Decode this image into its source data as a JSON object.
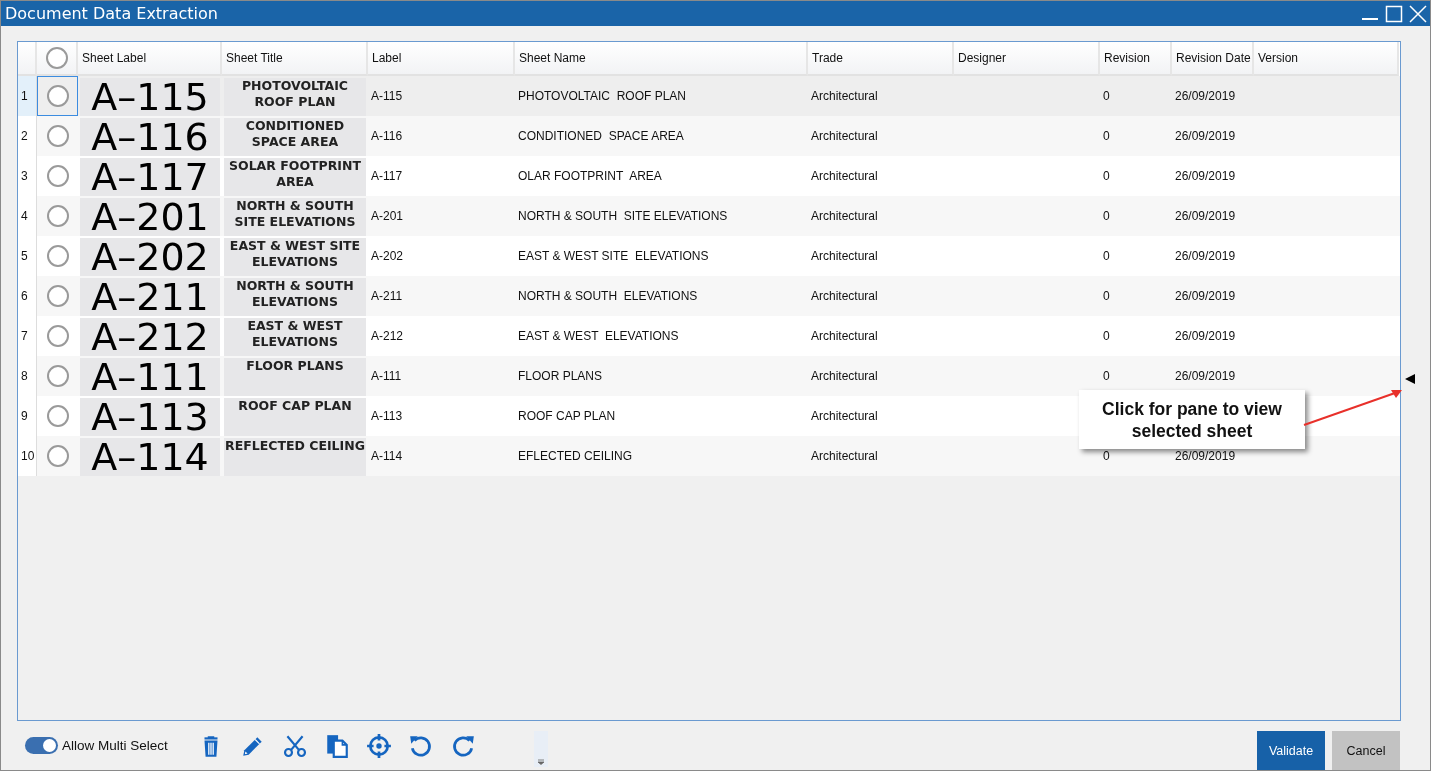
{
  "window": {
    "title": "Document Data Extraction"
  },
  "table": {
    "columns": [
      "Sheet Label",
      "Sheet Title",
      "Label",
      "Sheet Name",
      "Trade",
      "Designer",
      "Revision",
      "Revision Date",
      "Version"
    ],
    "header_checked": false,
    "rows": [
      {
        "number": "1",
        "selected": true,
        "checked": false,
        "sheet_label": "A–115",
        "sheet_title": "PHOTOVOLTAIC\nROOF PLAN",
        "label": "A-115",
        "sheet_name": "PHOTOVOLTAIC  ROOF PLAN",
        "trade": "Architectural",
        "revision": "0",
        "revision_date": "26/09/2019"
      },
      {
        "number": "2",
        "selected": false,
        "checked": false,
        "sheet_label": "A–116",
        "sheet_title": "CONDITIONED\nSPACE AREA",
        "label": "A-116",
        "sheet_name": "CONDITIONED  SPACE AREA",
        "trade": "Architectural",
        "revision": "0",
        "revision_date": "26/09/2019"
      },
      {
        "number": "3",
        "selected": false,
        "checked": false,
        "sheet_label": "A–117",
        "sheet_title": "SOLAR FOOTPRINT\nAREA",
        "label": "A-117",
        "sheet_name": "OLAR FOOTPRINT  AREA",
        "trade": "Architectural",
        "revision": "0",
        "revision_date": "26/09/2019"
      },
      {
        "number": "4",
        "selected": false,
        "checked": false,
        "sheet_label": "A–201",
        "sheet_title": "NORTH & SOUTH\nSITE ELEVATIONS",
        "label": "A-201",
        "sheet_name": "NORTH & SOUTH  SITE ELEVATIONS",
        "trade": "Architectural",
        "revision": "0",
        "revision_date": "26/09/2019"
      },
      {
        "number": "5",
        "selected": false,
        "checked": false,
        "sheet_label": "A–202",
        "sheet_title": "EAST & WEST SITE\nELEVATIONS",
        "label": "A-202",
        "sheet_name": "EAST & WEST SITE  ELEVATIONS",
        "trade": "Architectural",
        "revision": "0",
        "revision_date": "26/09/2019"
      },
      {
        "number": "6",
        "selected": false,
        "checked": false,
        "sheet_label": "A–211",
        "sheet_title": "NORTH & SOUTH\nELEVATIONS",
        "label": "A-211",
        "sheet_name": "NORTH & SOUTH  ELEVATIONS",
        "trade": "Architectural",
        "revision": "0",
        "revision_date": "26/09/2019"
      },
      {
        "number": "7",
        "selected": false,
        "checked": false,
        "sheet_label": "A–212",
        "sheet_title": "EAST & WEST\nELEVATIONS",
        "label": "A-212",
        "sheet_name": "EAST & WEST  ELEVATIONS",
        "trade": "Architectural",
        "revision": "0",
        "revision_date": "26/09/2019"
      },
      {
        "number": "8",
        "selected": false,
        "checked": false,
        "sheet_label": "A–111",
        "sheet_title": "FLOOR PLANS",
        "label": "A-111",
        "sheet_name": "FLOOR PLANS",
        "trade": "Architectural",
        "revision": "0",
        "revision_date": "26/09/2019"
      },
      {
        "number": "9",
        "selected": false,
        "checked": false,
        "sheet_label": "A–113",
        "sheet_title": "ROOF CAP PLAN",
        "label": "A-113",
        "sheet_name": "ROOF CAP PLAN",
        "trade": "Architectural"
      },
      {
        "number": "10",
        "selected": false,
        "checked": false,
        "sheet_label": "A–114",
        "sheet_title": "REFLECTED CEILING",
        "label": "A-114",
        "sheet_name": "EFLECTED CEILING",
        "trade": "Architectural",
        "revision": "0",
        "revision_date": "26/09/2019"
      }
    ]
  },
  "callout": {
    "text": "Click for pane to view\nselected sheet"
  },
  "footer": {
    "toggle": {
      "label": "Allow Multi Select",
      "on": true
    },
    "buttons": [
      {
        "label": "Validate",
        "kind": "primary"
      },
      {
        "label": "Cancel",
        "kind": "secondary"
      }
    ]
  }
}
